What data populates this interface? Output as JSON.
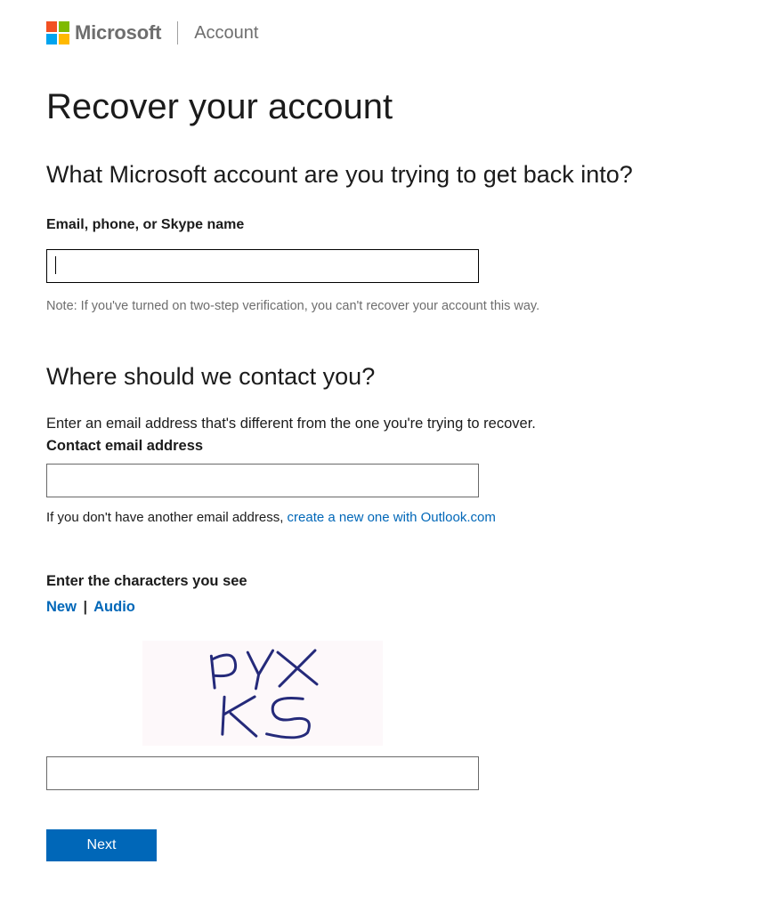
{
  "header": {
    "brand": "Microsoft",
    "subtitle": "Account"
  },
  "page": {
    "title": "Recover your account"
  },
  "section1": {
    "heading": "What Microsoft account are you trying to get back into?",
    "field_label": "Email, phone, or Skype name",
    "input_value": "",
    "note": "Note: If you've turned on two-step verification, you can't recover your account this way."
  },
  "section2": {
    "heading": "Where should we contact you?",
    "instruction": "Enter an email address that's different from the one you're trying to recover.",
    "field_label": "Contact email address",
    "input_value": "",
    "hint_prefix": "If you don't have another email address, ",
    "hint_link": "create a new one with Outlook.com"
  },
  "captcha": {
    "label": "Enter the characters you see",
    "link_new": "New",
    "separator": "|",
    "link_audio": "Audio",
    "image_text_line1": "pYX",
    "image_text_line2": "KS",
    "input_value": ""
  },
  "actions": {
    "next": "Next"
  }
}
